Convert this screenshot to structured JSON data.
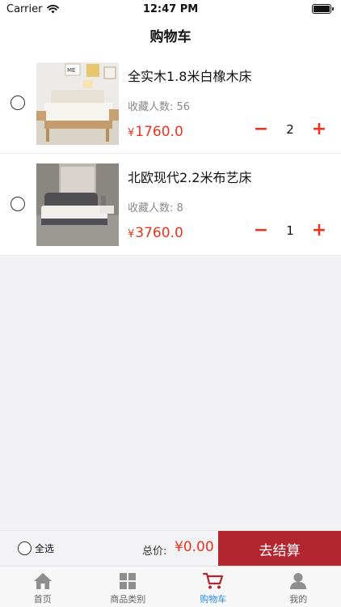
{
  "status": {
    "carrier": "Carrier",
    "time": "12:47 PM"
  },
  "nav": {
    "title": "购物车"
  },
  "cart": {
    "items": [
      {
        "name": "全实木1.8米白橡木床",
        "fav": "收藏人数: 56",
        "currency": "¥",
        "price": "1760.0",
        "qty": "2",
        "minus": "−",
        "plus": "+"
      },
      {
        "name": "北欧现代2.2米布艺床",
        "fav": "收藏人数: 8",
        "currency": "¥",
        "price": "3760.0",
        "qty": "1",
        "minus": "−",
        "plus": "+"
      }
    ]
  },
  "bottom": {
    "select_all": "全选",
    "total_label": "总价:",
    "total_value": "¥0.00",
    "checkout": "去结算"
  },
  "tabs": [
    {
      "label": "首页",
      "icon": "home-icon"
    },
    {
      "label": "商品类别",
      "icon": "grid-icon"
    },
    {
      "label": "购物车",
      "icon": "cart-icon",
      "active": true
    },
    {
      "label": "我的",
      "icon": "user-icon"
    }
  ],
  "colors": {
    "accent": "#e8341e",
    "checkout": "#b22630",
    "tab_active": "#2a8be8"
  }
}
